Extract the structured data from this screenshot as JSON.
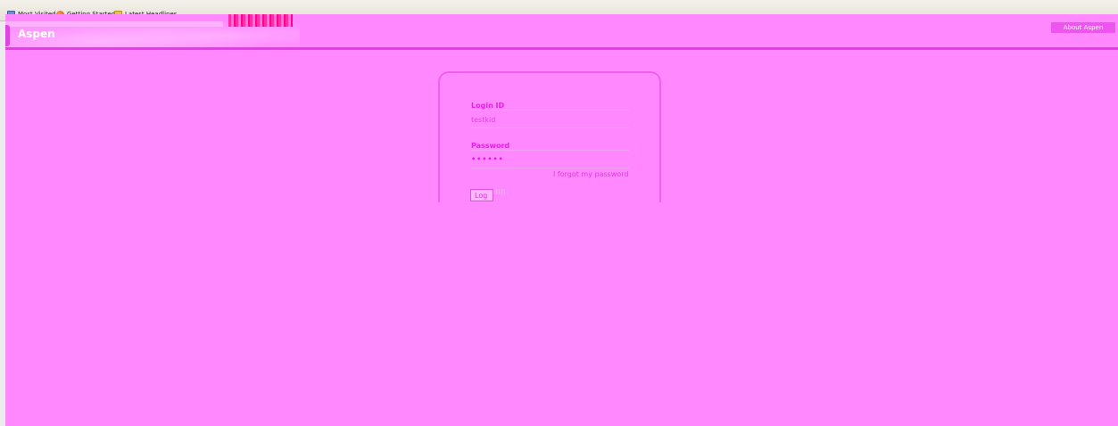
{
  "browser": {
    "bookmarks": [
      {
        "label": "Most Visited",
        "icon": "most-visited-icon"
      },
      {
        "label": "Getting Started",
        "icon": "firefox-icon"
      },
      {
        "label": "Latest Headlines",
        "icon": "rss-feed-icon"
      }
    ]
  },
  "header": {
    "app_title": "Aspen",
    "about_label": "About Aspen"
  },
  "login": {
    "login_id_label": "Login ID",
    "login_id_value": "testkid",
    "password_label": "Password",
    "password_masked": "••••••",
    "forgot_link": "I forgot my password",
    "login_button": "Log"
  },
  "colors": {
    "background": "#ff88ff",
    "accent": "#e61ee6",
    "header_line": "#e63ee6"
  }
}
